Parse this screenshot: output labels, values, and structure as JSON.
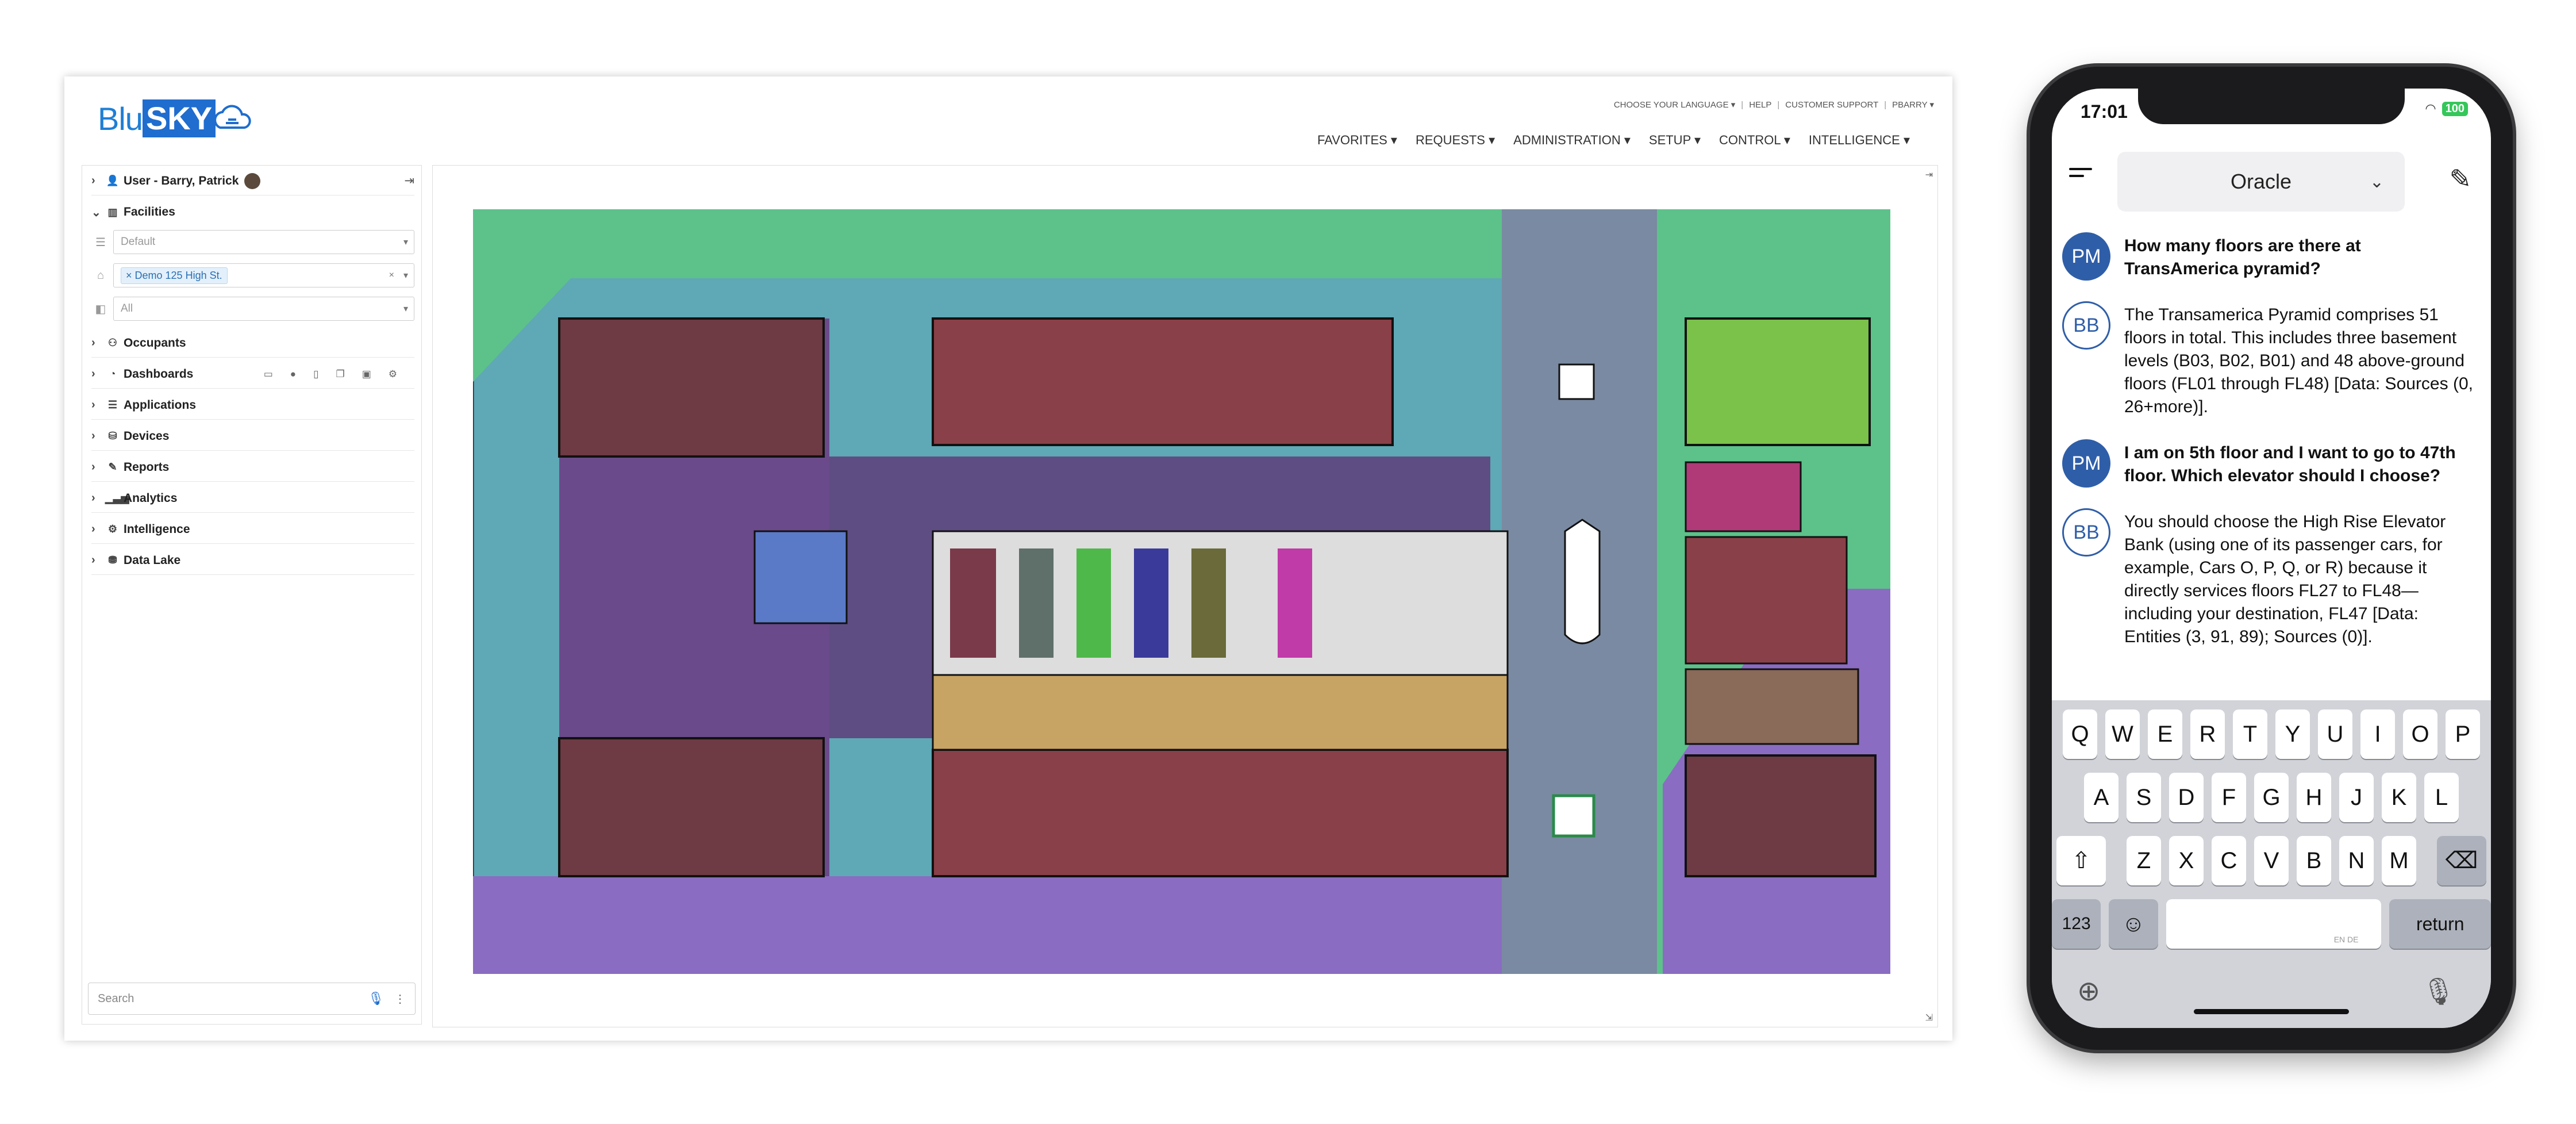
{
  "app": {
    "logo_text_left": "Blu",
    "logo_text_right": "SKY",
    "brand_color": "#1f6dcf"
  },
  "top_links": [
    "CHOOSE YOUR LANGUAGE ▾",
    "HELP",
    "CUSTOMER SUPPORT",
    "PBARRY ▾"
  ],
  "main_nav": [
    "FAVORITES ▾",
    "REQUESTS ▾",
    "ADMINISTRATION ▾",
    "SETUP ▾",
    "CONTROL ▾",
    "INTELLIGENCE ▾"
  ],
  "sidebar": {
    "user_label": "User - Barry, Patrick",
    "facilities_label": "Facilities",
    "filters": {
      "level_placeholder": "Default",
      "site_tag": "Demo 125 High St.",
      "floor_value": "All"
    },
    "items": [
      "Occupants",
      "Dashboards",
      "Applications",
      "Devices",
      "Reports",
      "Analytics",
      "Intelligence",
      "Data Lake"
    ],
    "search_placeholder": "Search"
  },
  "phone": {
    "time": "17:01",
    "battery": "100",
    "model": "Oracle",
    "messages": [
      {
        "role": "user",
        "avatar": "PM",
        "text": "How many floors are there at TransAmerica pyramid?"
      },
      {
        "role": "bot",
        "avatar": "BB",
        "text": "The Transamerica Pyramid comprises 51 floors in total. This includes three basement levels (B03, B02, B01) and 48 above-ground floors (FL01 through FL48) [Data: Sources (0, 26+more)]."
      },
      {
        "role": "user",
        "avatar": "PM",
        "text": "I am on 5th floor and I want to go to 47th floor. Which elevator should I choose?"
      },
      {
        "role": "bot",
        "avatar": "BB",
        "text": "You should choose the High Rise Elevator Bank (using one of its passenger cars, for example, Cars O, P, Q, or R) because it directly services floors FL27 to FL48—including your destination, FL47 [Data: Entities (3, 91, 89); Sources (0)]."
      }
    ],
    "keyboard": {
      "row1": [
        "Q",
        "W",
        "E",
        "R",
        "T",
        "Y",
        "U",
        "I",
        "O",
        "P"
      ],
      "row2": [
        "A",
        "S",
        "D",
        "F",
        "G",
        "H",
        "J",
        "K",
        "L"
      ],
      "row3": [
        "Z",
        "X",
        "C",
        "V",
        "B",
        "N",
        "M"
      ],
      "numbers_key": "123",
      "return_key": "return",
      "space_lang": "EN DE"
    }
  },
  "colors": {
    "space_maroon": "#6e3a44",
    "space_green": "#5cc28a",
    "space_purple": "#8a6cc2",
    "space_slate": "#7a8aa2",
    "space_tan": "#c8a464",
    "accent_blue": "#2f5ea8"
  }
}
